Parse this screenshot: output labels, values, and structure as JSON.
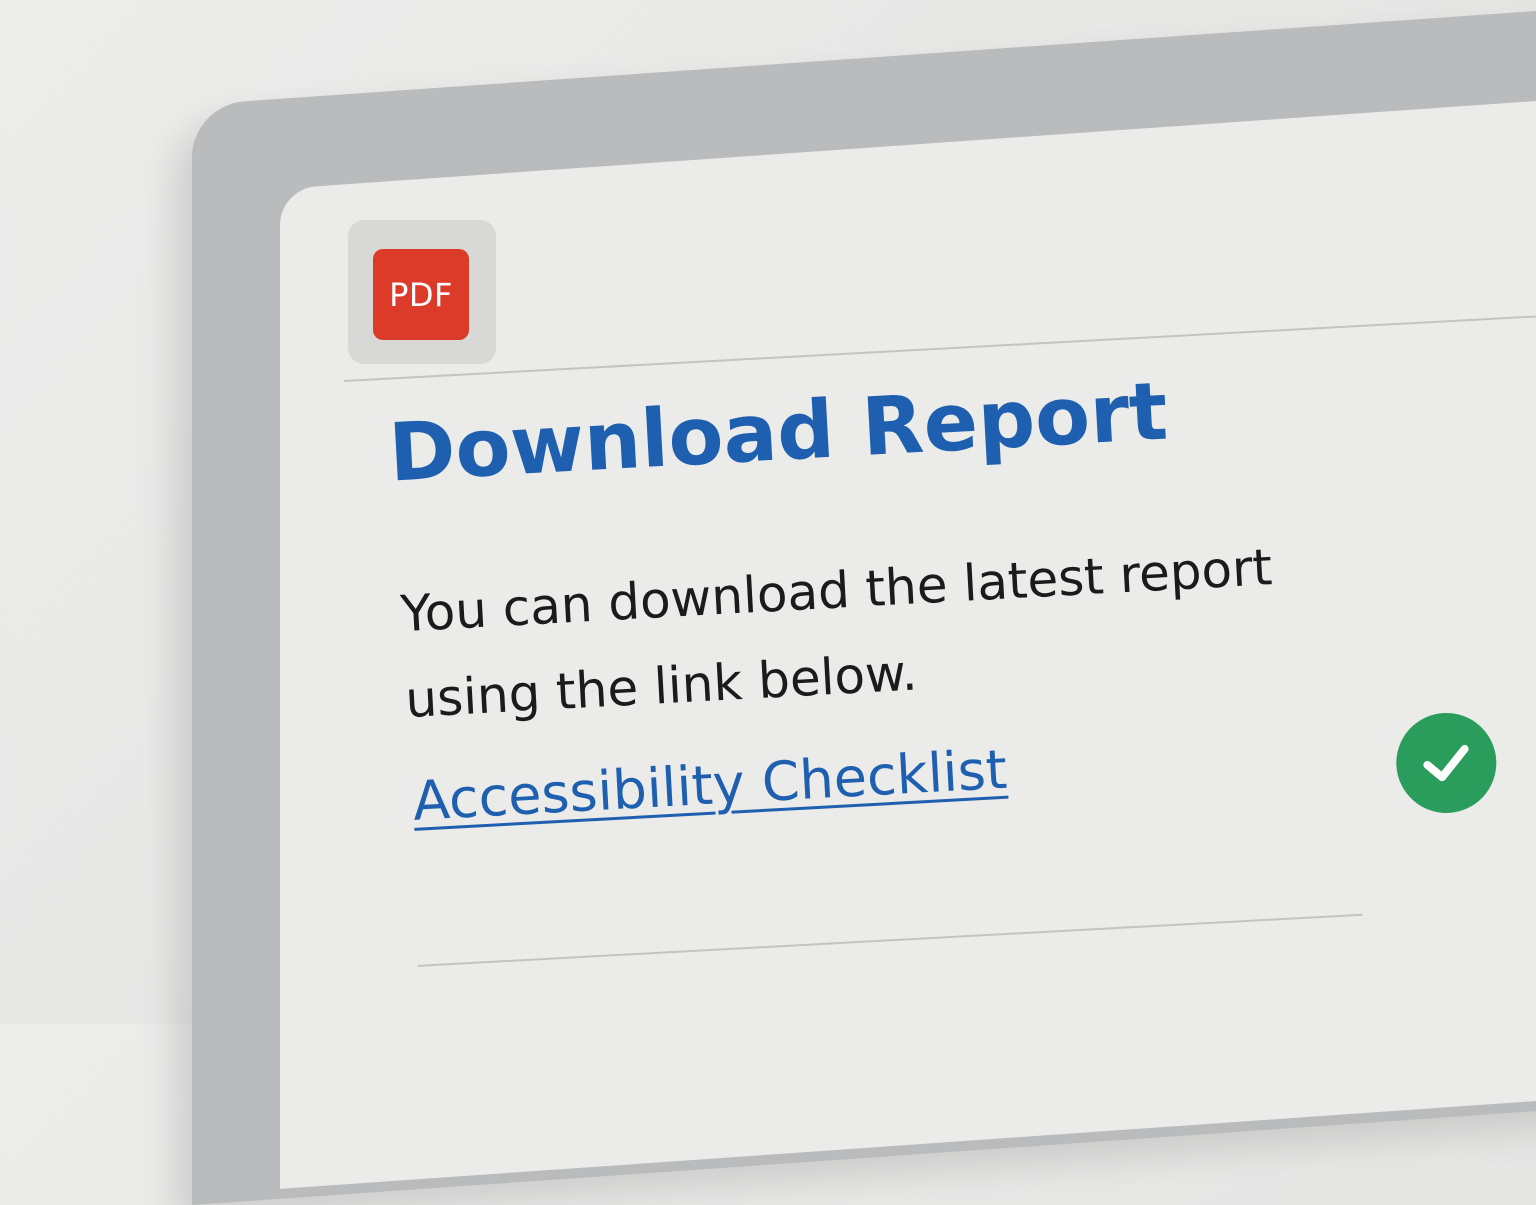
{
  "document": {
    "file_badge": "PDF",
    "title": "Download Report",
    "description": "You can download the latest report using the link below.",
    "link_label": "Accessibility Checklist",
    "status_icon": "check-icon"
  },
  "colors": {
    "title": "#1f5faf",
    "link": "#1f5faf",
    "pdf_badge": "#dd3b2a",
    "success": "#2a9d5c",
    "body_text": "#1b1b1b"
  }
}
